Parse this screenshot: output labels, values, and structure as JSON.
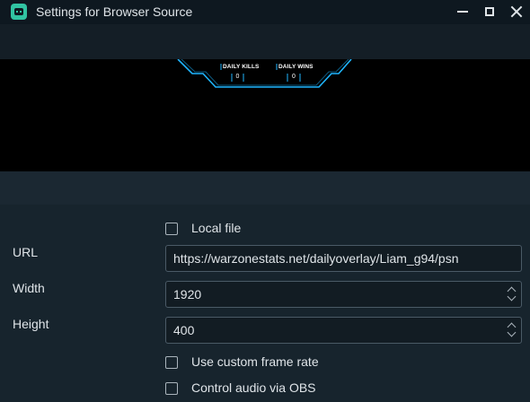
{
  "window": {
    "title": "Settings for Browser Source"
  },
  "preview": {
    "overlay": {
      "stats": [
        {
          "label": "DAILY KILLS",
          "value": "0"
        },
        {
          "label": "DAILY WINS",
          "value": "0"
        }
      ],
      "accent_color": "#1fb6ff"
    }
  },
  "form": {
    "local_file_label": "Local file",
    "url_label": "URL",
    "url_value": "https://warzonestats.net/dailyoverlay/Liam_g94/psn",
    "width_label": "Width",
    "width_value": "1920",
    "height_label": "Height",
    "height_value": "400",
    "custom_frame_rate_label": "Use custom frame rate",
    "control_audio_label": "Control audio via OBS"
  },
  "colors": {
    "titlebar": "#0e1820",
    "panel": "#17242d",
    "accent_icon": "#31c3a2"
  }
}
